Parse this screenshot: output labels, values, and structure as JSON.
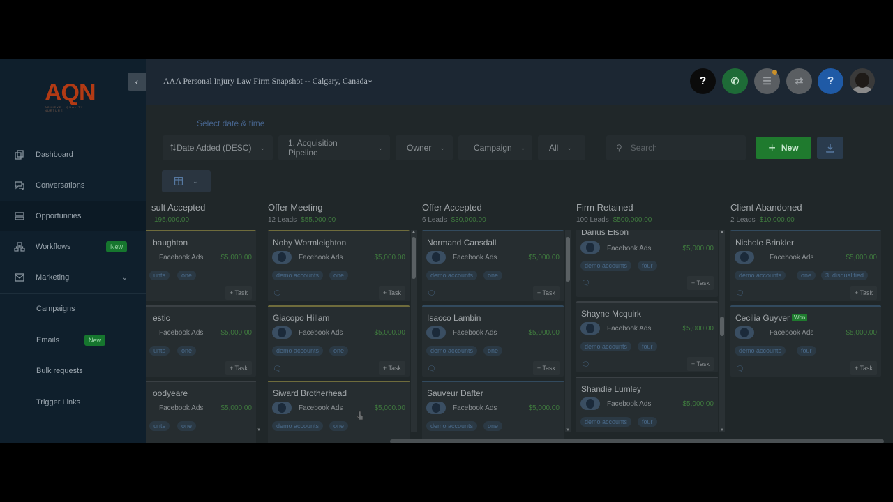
{
  "sidebar": {
    "logo": {
      "text": "AQN",
      "tagline": "ACHIEVE · QUALITY · NURTURE"
    },
    "collapse_icon": "chevron-left-icon",
    "items": [
      {
        "label": "Dashboard",
        "icon": "dashboard-icon"
      },
      {
        "label": "Conversations",
        "icon": "chat-icon"
      },
      {
        "label": "Opportunities",
        "icon": "pipeline-icon",
        "active": true
      },
      {
        "label": "Workflows",
        "icon": "workflow-icon",
        "badge": "New"
      },
      {
        "label": "Marketing",
        "icon": "mail-icon",
        "expanded": true
      }
    ],
    "subitems": [
      {
        "label": "Campaigns"
      },
      {
        "label": "Emails",
        "badge": "New"
      },
      {
        "label": "Bulk requests"
      },
      {
        "label": "Trigger Links"
      }
    ]
  },
  "topbar": {
    "location": "AAA Personal Injury Law Firm Snapshot -- Calgary, Canada",
    "buttons": [
      {
        "name": "help-button",
        "glyph": "?",
        "bg": "#0b0b0b",
        "fg": "#ffffff"
      },
      {
        "name": "phone-button",
        "glyph": "✆",
        "bg": "#1e6b37",
        "fg": "#c8e6cf"
      },
      {
        "name": "notifications-button",
        "glyph": "☰",
        "bg": "#5a5e62",
        "fg": "#9a9ea2"
      },
      {
        "name": "switch-button",
        "glyph": "⇄",
        "bg": "#5a5e62",
        "fg": "#9a9ea2"
      },
      {
        "name": "support-button",
        "glyph": "?",
        "bg": "#1f5aa6",
        "fg": "#cfe0f5"
      }
    ]
  },
  "toolbar": {
    "date_link": "Select date & time",
    "sort": "Date Added (DESC)",
    "pipeline": "1. Acquisition Pipeline",
    "owner": "Owner",
    "campaign": "Campaign",
    "status": "All",
    "search_placeholder": "Search",
    "new_label": "New"
  },
  "columns": [
    {
      "title": "sult Accepted",
      "meta_count": "",
      "meta_amount": "195,000.00",
      "cards": [
        {
          "name": "baughton",
          "source": "Facebook Ads",
          "amount": "$5,000.00",
          "tags": [
            "unts",
            "one"
          ],
          "task": "+ Task",
          "border": "yellow"
        },
        {
          "name": "estic",
          "source": "Facebook Ads",
          "amount": "$5,000.00",
          "tags": [
            "unts",
            "one"
          ],
          "task": "+ Task",
          "border": "none"
        },
        {
          "name": "oodyeare",
          "source": "Facebook Ads",
          "amount": "$5,000.00",
          "tags": [
            "unts",
            "one"
          ],
          "task": "",
          "border": "none"
        }
      ]
    },
    {
      "title": "Offer Meeting",
      "meta_count": "12 Leads",
      "meta_amount": "$55,000.00",
      "cards": [
        {
          "name": "Noby Wormleighton",
          "source": "Facebook Ads",
          "amount": "$5,000.00",
          "tags": [
            "demo accounts",
            "one"
          ],
          "task": "+ Task",
          "border": "yellow"
        },
        {
          "name": "Giacopo Hillam",
          "source": "Facebook Ads",
          "amount": "$5,000.00",
          "tags": [
            "demo accounts",
            "one"
          ],
          "task": "+ Task",
          "border": "yellow"
        },
        {
          "name": "Siward Brotherhead",
          "source": "Facebook Ads",
          "amount": "$5,000.00",
          "tags": [
            "demo accounts",
            "one"
          ],
          "task": "",
          "border": "yellow"
        }
      ]
    },
    {
      "title": "Offer Accepted",
      "meta_count": "6 Leads",
      "meta_amount": "$30,000.00",
      "cards": [
        {
          "name": "Normand Cansdall",
          "source": "Facebook Ads",
          "amount": "$5,000.00",
          "tags": [
            "demo accounts",
            "one"
          ],
          "task": "+ Task",
          "border": "blue"
        },
        {
          "name": "Isacco Lambin",
          "source": "Facebook Ads",
          "amount": "$5,000.00",
          "tags": [
            "demo accounts",
            "one"
          ],
          "task": "+ Task",
          "border": "blue"
        },
        {
          "name": "Sauveur Dafter",
          "source": "Facebook Ads",
          "amount": "$5,000.00",
          "tags": [
            "demo accounts",
            "one"
          ],
          "task": "",
          "border": "blue"
        }
      ]
    },
    {
      "title": "Firm Retained",
      "meta_count": "100 Leads",
      "meta_amount": "$500,000.00",
      "cards": [
        {
          "name": "Darius Elson",
          "source": "Facebook Ads",
          "amount": "$5,000.00",
          "tags": [
            "demo accounts",
            "four"
          ],
          "task": "+ Task",
          "border": "none"
        },
        {
          "name": "Shayne Mcquirk",
          "source": "Facebook Ads",
          "amount": "$5,000.00",
          "tags": [
            "demo accounts",
            "four"
          ],
          "task": "+ Task",
          "border": "none"
        },
        {
          "name": "Shandie Lumley",
          "source": "Facebook Ads",
          "amount": "$5,000.00",
          "tags": [
            "demo accounts",
            "four"
          ],
          "task": "",
          "border": "none"
        }
      ]
    },
    {
      "title": "Client Abandoned",
      "meta_count": "2 Leads",
      "meta_amount": "$10,000.00",
      "cards": [
        {
          "name": "Nichole Brinkler",
          "source": "Facebook Ads",
          "amount": "$5,000.00",
          "tags": [
            "demo accounts",
            "one",
            "3. disqualified"
          ],
          "task": "+ Task",
          "border": "blue"
        },
        {
          "name": "Cecilia Guyver",
          "won": "Won",
          "source": "Facebook Ads",
          "amount": "$5,000.00",
          "tags": [
            "demo accounts",
            "four"
          ],
          "task": "+ Task",
          "border": "blue"
        }
      ]
    }
  ]
}
